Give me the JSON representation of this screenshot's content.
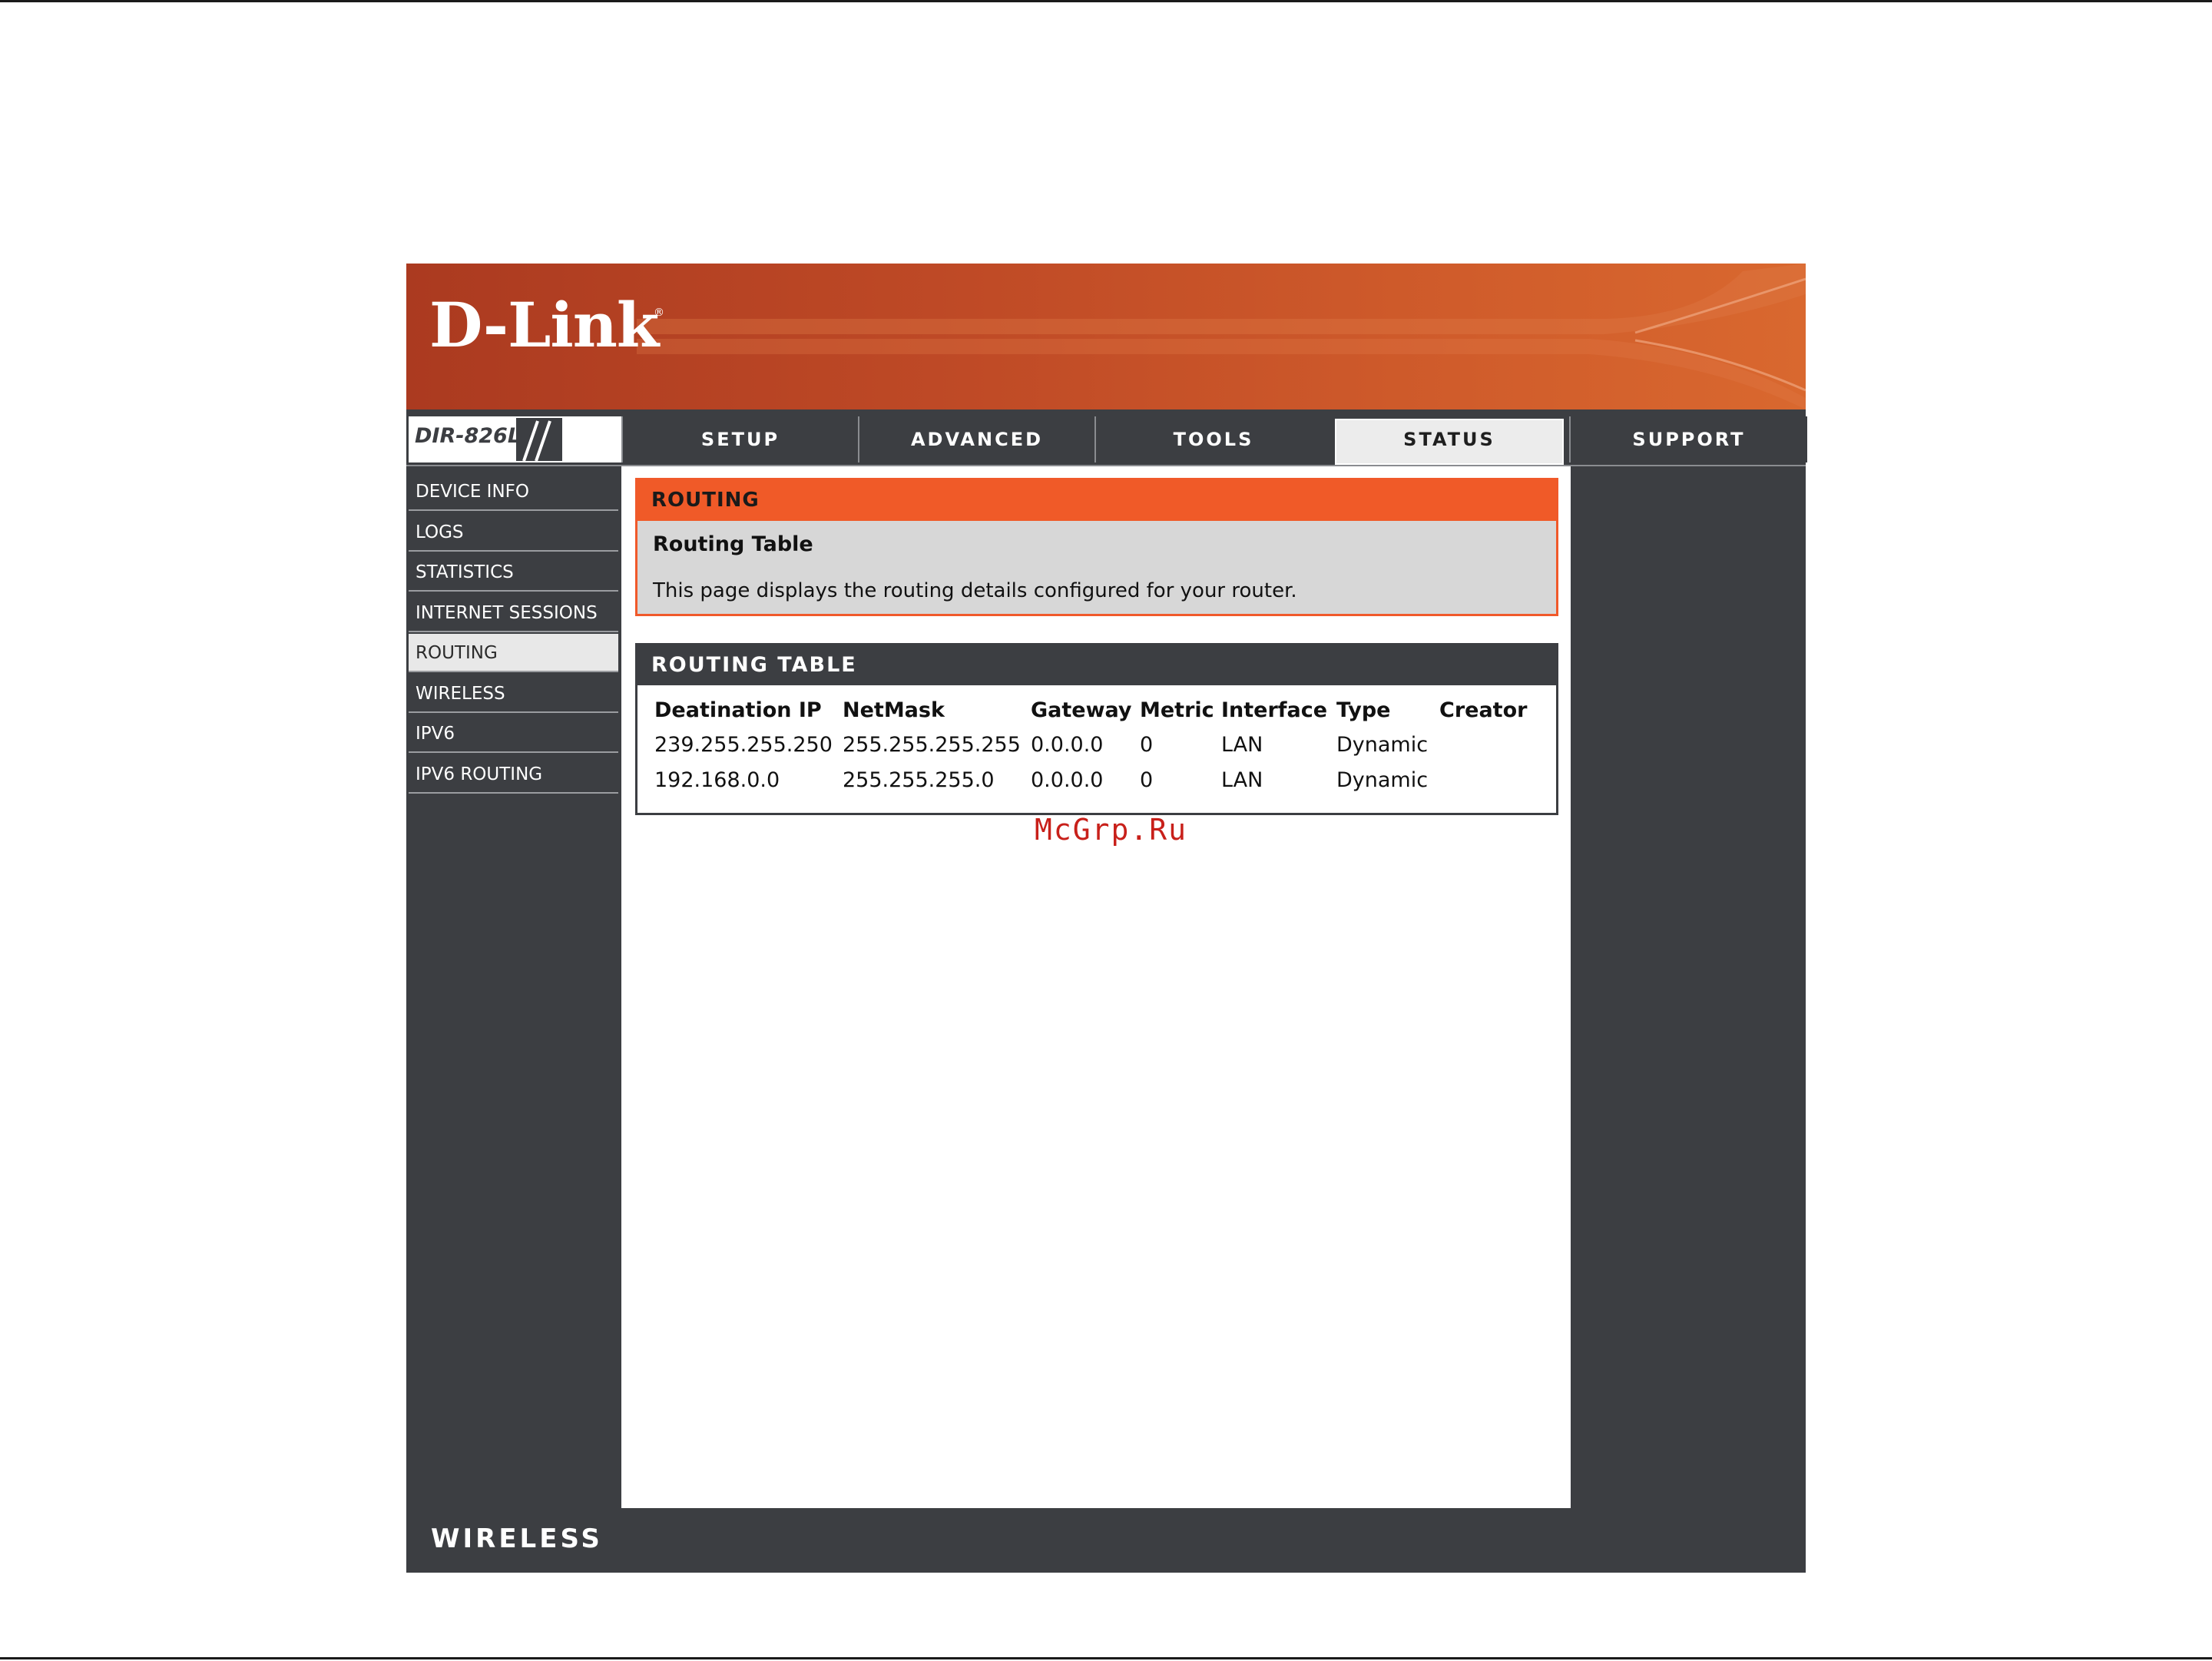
{
  "brand": {
    "logo": "D-Link",
    "reg": "®",
    "model": "DIR-826L",
    "footer": "WIRELESS"
  },
  "tabs": [
    "SETUP",
    "ADVANCED",
    "TOOLS",
    "STATUS",
    "SUPPORT"
  ],
  "active_tab": "STATUS",
  "sidebar": {
    "items": [
      "DEVICE INFO",
      "LOGS",
      "STATISTICS",
      "INTERNET SESSIONS",
      "ROUTING",
      "WIRELESS",
      "IPV6",
      "IPV6 ROUTING"
    ],
    "active": "ROUTING"
  },
  "routing_section": {
    "title": "ROUTING",
    "subtitle": "Routing Table",
    "description": "This page displays the routing details configured for your router."
  },
  "routing_table": {
    "title": "ROUTING TABLE",
    "columns": [
      "Deatination IP",
      "NetMask",
      "Gateway",
      "Metric",
      "Interface",
      "Type",
      "Creator"
    ],
    "rows": [
      [
        "239.255.255.250",
        "255.255.255.255",
        "0.0.0.0",
        "0",
        "LAN",
        "Dynamic",
        ""
      ],
      [
        "192.168.0.0",
        "255.255.255.0",
        "0.0.0.0",
        "0",
        "LAN",
        "Dynamic",
        ""
      ]
    ]
  },
  "watermark": "McGrp.Ru",
  "colors": {
    "accent": "#f05a28",
    "dark": "#3c3e42",
    "banner": "#bf4a26"
  }
}
